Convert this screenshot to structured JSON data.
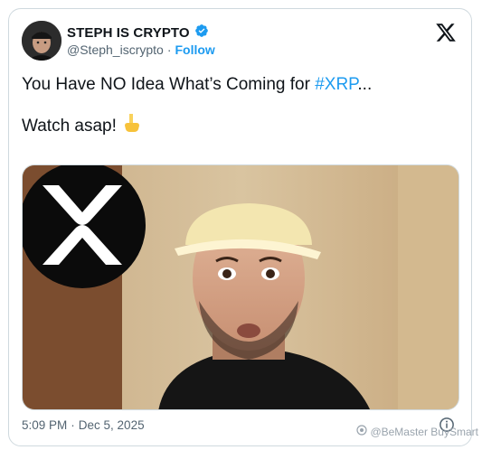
{
  "author": {
    "name": "STEPH IS CRYPTO",
    "handle": "@Steph_iscrypto",
    "separator": "·",
    "follow_label": "Follow"
  },
  "tweet": {
    "text_before": "You Have NO Idea What’s Coming for ",
    "hashtag": "#XRP",
    "text_after": "...",
    "line2": "Watch asap!",
    "line2_emoji": "👇"
  },
  "meta": {
    "time": "5:09 PM",
    "separator": "·",
    "date": "Dec 5, 2025"
  },
  "watermark": "@BeMaster BuySmart",
  "colors": {
    "accent": "#1d9bf0",
    "text": "#0f1419",
    "muted": "#536471",
    "border": "#cfd9de"
  },
  "icons": [
    "verified-badge-icon",
    "x-logo-icon",
    "info-icon",
    "xrp-logo-icon",
    "pointing-down-emoji"
  ]
}
